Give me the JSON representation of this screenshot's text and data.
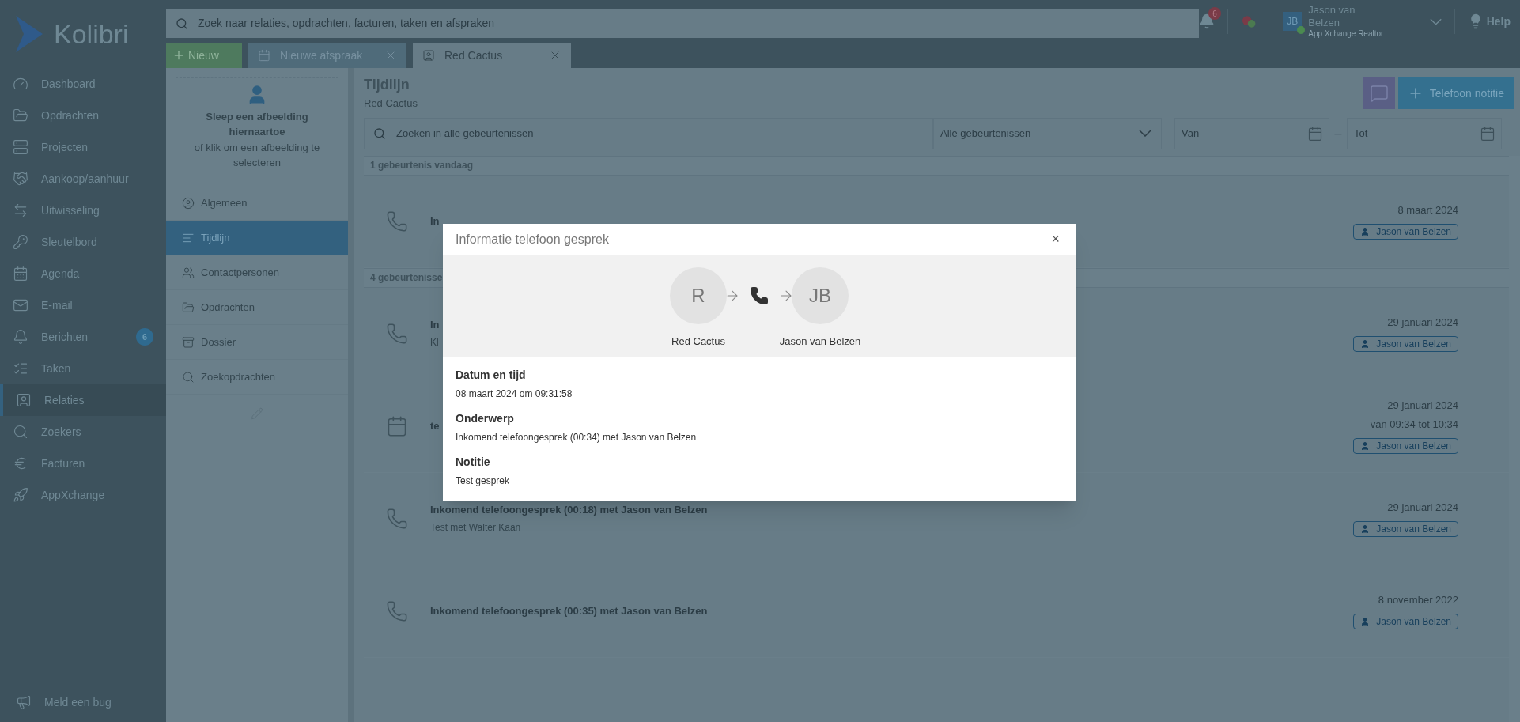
{
  "app": {
    "logo": "Kolibri"
  },
  "search": {
    "placeholder": "Zoek naar relaties, opdrachten, facturen, taken en afspraken"
  },
  "topbar": {
    "notifications": "6",
    "user": {
      "initials": "JB",
      "name": "Jason van Belzen",
      "role": "App Xchange Realtor",
      "online": true
    },
    "help": "Help"
  },
  "new_button": "Nieuw",
  "tabs": [
    {
      "label": "Nieuwe afspraak",
      "kind": "appointment",
      "selected": false
    },
    {
      "label": "Red Cactus",
      "kind": "contact",
      "selected": true
    }
  ],
  "sidebar": {
    "items": [
      {
        "label": "Dashboard",
        "selected": false
      },
      {
        "label": "Opdrachten",
        "selected": false
      },
      {
        "label": "Projecten",
        "selected": false
      },
      {
        "label": "Aankoop/aanhuur",
        "selected": false
      },
      {
        "label": "Uitwisseling",
        "selected": false
      },
      {
        "label": "Sleutelbord",
        "selected": false
      },
      {
        "label": "Agenda",
        "selected": false
      },
      {
        "label": "E-mail",
        "selected": false
      },
      {
        "label": "Berichten",
        "selected": false,
        "badge": "6"
      },
      {
        "label": "Taken",
        "selected": false
      },
      {
        "label": "Relaties",
        "selected": true
      },
      {
        "label": "Zoekers",
        "selected": false
      },
      {
        "label": "Facturen",
        "selected": false
      },
      {
        "label": "AppXchange",
        "selected": false
      }
    ],
    "footer": "Meld een bug"
  },
  "contact_panel": {
    "upload_title": "Sleep een afbeelding hiernaartoe",
    "upload_hint": "of klik om een afbeelding te selecteren",
    "menu": [
      {
        "label": "Algemeen",
        "selected": false
      },
      {
        "label": "Tijdlijn",
        "selected": true
      },
      {
        "label": "Contactpersonen",
        "selected": false
      },
      {
        "label": "Opdrachten",
        "selected": false
      },
      {
        "label": "Dossier",
        "selected": false
      },
      {
        "label": "Zoekopdrachten",
        "selected": false
      }
    ]
  },
  "timeline": {
    "title": "Tijdlijn",
    "subtitle": "Red Cactus",
    "add_button": "Telefoon notitie",
    "filters": {
      "search_placeholder": "Zoeken in alle gebeurtenissen",
      "type": "Alle gebeurtenissen",
      "from_placeholder": "Van",
      "separator": "–",
      "to_placeholder": "Tot"
    },
    "groups": [
      {
        "header": "1 gebeurtenis vandaag",
        "events": [
          {
            "kind": "call",
            "title": "In",
            "date": "8 maart 2024",
            "user": "Jason van Belzen"
          }
        ]
      },
      {
        "header": "4 gebeurtenisse",
        "events": [
          {
            "kind": "call",
            "title": "In",
            "note": "Kl",
            "date": "29 januari 2024",
            "user": "Jason van Belzen"
          },
          {
            "kind": "appointment",
            "title": "te",
            "date": "29 januari 2024",
            "time": "van 09:34 tot 10:34",
            "user": "Jason van Belzen"
          },
          {
            "kind": "call",
            "title": "Inkomend telefoongesprek (00:18) met Jason van Belzen",
            "note": "Test met Walter Kaan",
            "date": "29 januari 2024",
            "user": "Jason van Belzen"
          },
          {
            "kind": "call",
            "title": "Inkomend telefoongesprek (00:35) met Jason van Belzen",
            "date": "8 november 2022",
            "user": "Jason van Belzen"
          }
        ]
      }
    ]
  },
  "modal": {
    "title": "Informatie telefoon gesprek",
    "close": "×",
    "caller": {
      "initials": "R",
      "name": "Red Cactus"
    },
    "callee": {
      "initials": "JB",
      "name": "Jason van Belzen"
    },
    "fields": [
      {
        "label": "Datum en tijd",
        "value": "08 maart 2024 om 09:31:58"
      },
      {
        "label": "Onderwerp",
        "value": "Inkomend telefoongesprek (00:34) met Jason van Belzen"
      },
      {
        "label": "Notitie",
        "value": "Test gesprek"
      }
    ]
  }
}
